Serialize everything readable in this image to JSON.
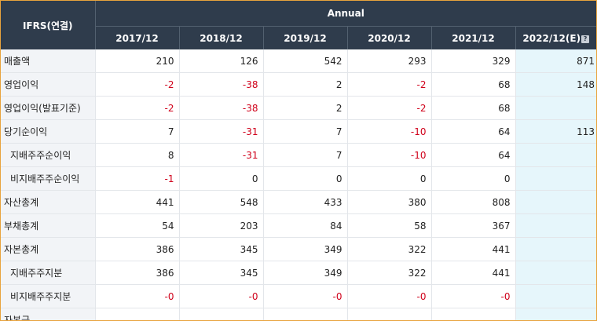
{
  "header": {
    "standard": "IFRS(연결)",
    "group": "Annual",
    "years": [
      "2017/12",
      "2018/12",
      "2019/12",
      "2020/12",
      "2021/12",
      "2022/12(E)"
    ],
    "help_icon": "?"
  },
  "rows": [
    {
      "label": "매출액",
      "sub": false,
      "values": [
        "210",
        "126",
        "542",
        "293",
        "329",
        "871"
      ]
    },
    {
      "label": "영업이익",
      "sub": false,
      "values": [
        "-2",
        "-38",
        "2",
        "-2",
        "68",
        "148"
      ]
    },
    {
      "label": "영업이익(발표기준)",
      "sub": false,
      "values": [
        "-2",
        "-38",
        "2",
        "-2",
        "68",
        ""
      ]
    },
    {
      "label": "당기순이익",
      "sub": false,
      "values": [
        "7",
        "-31",
        "7",
        "-10",
        "64",
        "113"
      ]
    },
    {
      "label": "지배주주순이익",
      "sub": true,
      "values": [
        "8",
        "-31",
        "7",
        "-10",
        "64",
        ""
      ]
    },
    {
      "label": "비지배주주순이익",
      "sub": true,
      "values": [
        "-1",
        "0",
        "0",
        "0",
        "0",
        ""
      ]
    },
    {
      "label": "자산총계",
      "sub": false,
      "values": [
        "441",
        "548",
        "433",
        "380",
        "808",
        ""
      ]
    },
    {
      "label": "부채총계",
      "sub": false,
      "values": [
        "54",
        "203",
        "84",
        "58",
        "367",
        ""
      ]
    },
    {
      "label": "자본총계",
      "sub": false,
      "values": [
        "386",
        "345",
        "349",
        "322",
        "441",
        ""
      ]
    },
    {
      "label": "지배주주지분",
      "sub": true,
      "values": [
        "386",
        "345",
        "349",
        "322",
        "441",
        ""
      ]
    },
    {
      "label": "비지배주주지분",
      "sub": true,
      "values": [
        "-0",
        "-0",
        "-0",
        "-0",
        "-0",
        ""
      ]
    },
    {
      "label": "자본금",
      "sub": false,
      "values": [
        "",
        "",
        "",
        "",
        "",
        ""
      ]
    }
  ],
  "colors": {
    "header_bg": "#2f3c4c",
    "negative": "#d0021b",
    "estimate_bg": "#e6f6fb",
    "label_bg": "#f2f4f7",
    "frame": "#e8a33d"
  }
}
